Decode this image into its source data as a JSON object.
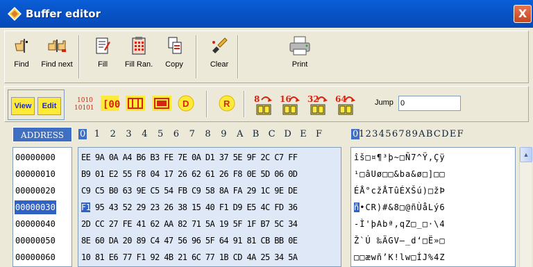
{
  "window": {
    "title": "Buffer editor",
    "close_label": "X"
  },
  "toolbar": {
    "buttons": [
      {
        "label": "Find",
        "icon": "find-icon"
      },
      {
        "label": "Find next",
        "icon": "find-next-icon"
      },
      {
        "label": "Fill",
        "icon": "fill-icon"
      },
      {
        "label": "Fill Ran.",
        "icon": "fill-random-icon"
      },
      {
        "label": "Copy",
        "icon": "copy-icon"
      },
      {
        "label": "Clear",
        "icon": "clear-icon"
      },
      {
        "label": "Print",
        "icon": "printer-icon"
      }
    ]
  },
  "row2": {
    "view_label": "View",
    "edit_label": "Edit",
    "bits_label": "1010\n10101",
    "d_label": "D",
    "r_label": "R",
    "bits": [
      "8",
      "16",
      "32",
      "64"
    ],
    "jump_label": "Jump",
    "jump_value": "0"
  },
  "grid": {
    "address_header": "ADDRESS",
    "hex_columns": [
      "0",
      "1",
      "2",
      "3",
      "4",
      "5",
      "6",
      "7",
      "8",
      "9",
      "A",
      "B",
      "C",
      "D",
      "E",
      "F"
    ],
    "ascii_header": "0123456789ABCDEF",
    "rows": [
      {
        "address": "00000000",
        "hex": "EE 9A 0A A4 B6 B3 FE 7E 0A D1 37 5E 9F 2C C7 FF",
        "ascii": "îš□¤¶³þ~□Ñ7^Ÿ,Çÿ"
      },
      {
        "address": "00000010",
        "hex": "B9 01 E2 55 F8 04 17 26 62 61 26 F8 0E 5D 06 0D",
        "ascii": "¹□âUø□□&ba&ø□]□□"
      },
      {
        "address": "00000020",
        "hex": "C9 C5 B0 63 9E C5 54 FB C9 58 8A FA 29 1C 9E DE",
        "ascii": "ÉÅ°cžÅTûÉXŠú)□žÞ"
      },
      {
        "address": "00000030",
        "hex_first": "F1",
        "hex_rest": " 95 43 52 29 23 26 38 15 40 F1 D9 E5 4C FD 36",
        "ascii_first": "ñ",
        "ascii_rest": "•CR)#&8□@ñÙåLý6"
      },
      {
        "address": "00000040",
        "hex": "2D CC 27 FE 41 62 AA 82 71 5A 19 5F 1F B7 5C 34",
        "ascii": "-Ì'þAbª‚qZ□_□·\\4"
      },
      {
        "address": "00000050",
        "hex": "8E 60 DA 20 89 C4 47 56 96 5F 64 91 81 CB BB 0E",
        "ascii": "Ž`Ú ‰ÄGV–_d‘□Ë»□"
      },
      {
        "address": "00000060",
        "hex": "10 81 E6 77 F1 92 4B 21 6C 77 1B CD 4A 25 34 5A",
        "ascii": "□□æwñ’K!lw□ÍJ%4Z"
      }
    ],
    "selected_row": "00000030"
  },
  "colors": {
    "titlebar": "#0853c6",
    "selection": "#2f62c4",
    "hex_panel_bg": "#dfe8f6",
    "window_bg": "#ece9d8",
    "accent_red": "#d62410",
    "button_yellow": "#ffea3a"
  }
}
